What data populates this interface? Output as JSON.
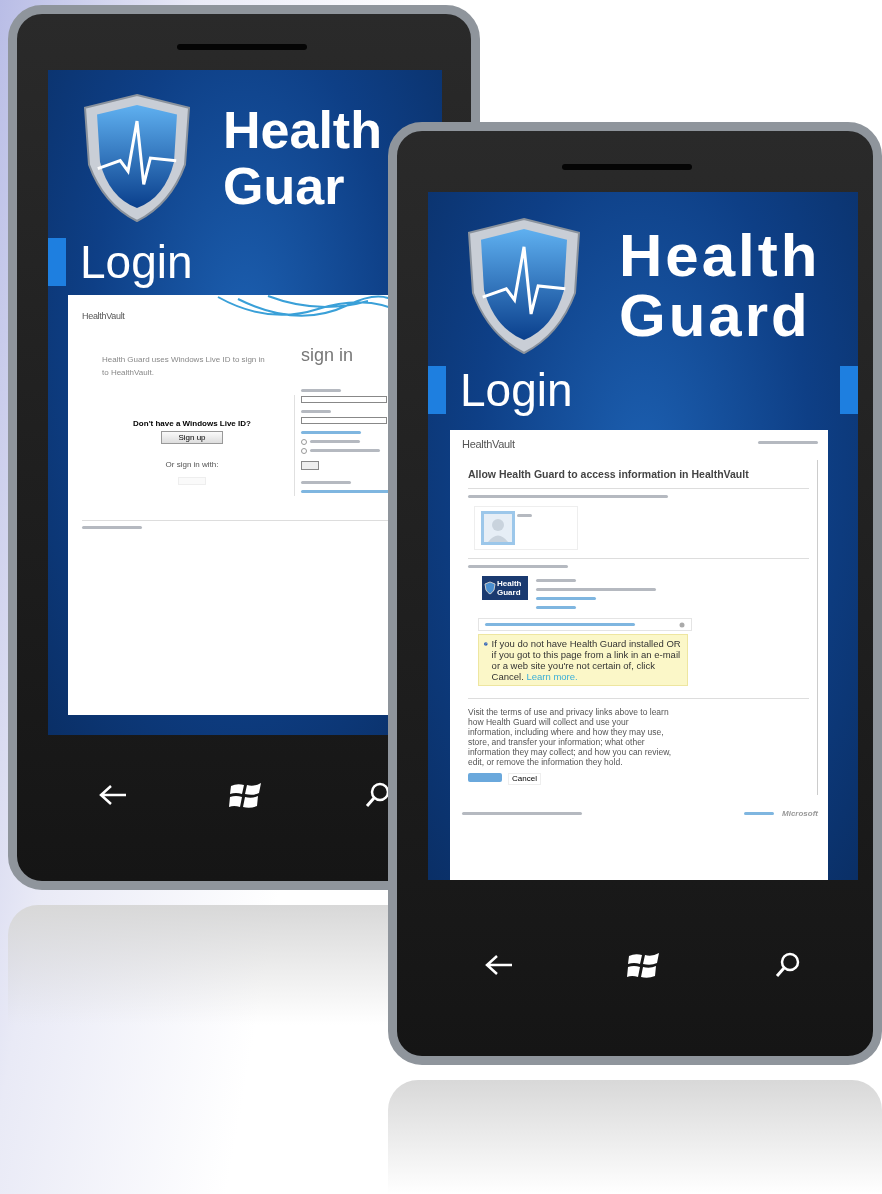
{
  "phones": [
    {
      "kind": "sign_in",
      "app_title": [
        "Health",
        "Guar"
      ],
      "page_title": "Login",
      "web": {
        "logo": "HealthVault",
        "intro": "Health Guard uses Windows Live ID to sign in to HealthVault.",
        "prompt": "Don't have a Windows Live ID?",
        "signup_button": "Sign up",
        "alt_signin": "Or sign in with:",
        "heading": "sign in",
        "options": [
          {
            "selected": false
          },
          {
            "selected": false
          }
        ]
      }
    },
    {
      "kind": "authorize",
      "app_title": [
        "Health",
        "Guard"
      ],
      "page_title": "Login",
      "web": {
        "logo": "HealthVault",
        "heading": "Allow Health Guard to access information in HealthVault",
        "app_logo": [
          "Health",
          "Guard"
        ],
        "warning": "If you do not have Health Guard installed OR if you got to this page from a link in an e-mail or a web site you're not certain of, click Cancel.",
        "warning_link": "Learn more.",
        "paragraph": "Visit the terms of use and privacy links above to learn how Health Guard will collect and use your information, including where and how they may use, store, and transfer your information; what other information they may collect; and how you can review, edit, or remove the information they hold.",
        "cancel_button": "Cancel",
        "brand": "Microsoft"
      }
    }
  ]
}
